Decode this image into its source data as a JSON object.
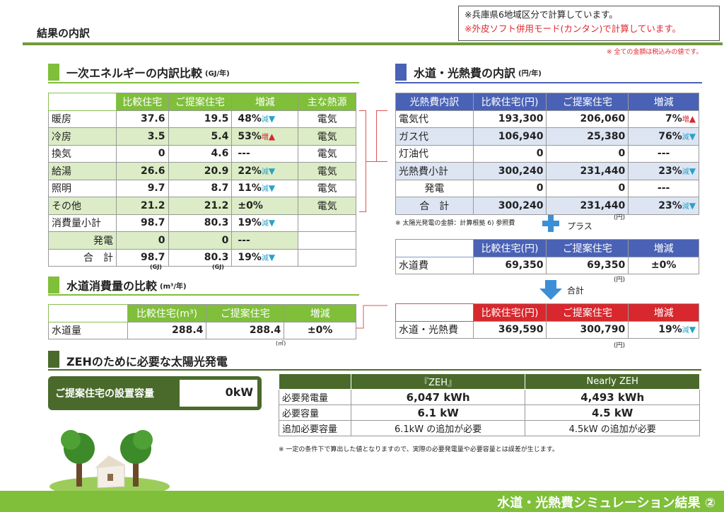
{
  "header": {
    "title": "結果の内訳",
    "note1": "※兵庫県6地域区分で計算しています。",
    "note2": "※外皮ソフト併用モード(カンタン)で計算しています。",
    "taxnote": "※ 全ての金額は税込みの値です。"
  },
  "energy": {
    "title": "一次エネルギーの内訳比較",
    "unit": "(GJ/年)",
    "headers": [
      "",
      "比較住宅",
      "ご提案住宅",
      "増減",
      "主な熱源"
    ],
    "rows": [
      {
        "label": "暖房",
        "a": "37.6",
        "b": "19.5",
        "pct": "48%",
        "dir": "減",
        "src": "電気"
      },
      {
        "label": "冷房",
        "a": "3.5",
        "b": "5.4",
        "pct": "53%",
        "dir": "増",
        "src": "電気"
      },
      {
        "label": "換気",
        "a": "0",
        "b": "4.6",
        "pct": "---",
        "dir": "",
        "src": "電気"
      },
      {
        "label": "給湯",
        "a": "26.6",
        "b": "20.9",
        "pct": "22%",
        "dir": "減",
        "src": "電気"
      },
      {
        "label": "照明",
        "a": "9.7",
        "b": "8.7",
        "pct": "11%",
        "dir": "減",
        "src": "電気"
      },
      {
        "label": "その他",
        "a": "21.2",
        "b": "21.2",
        "pct": "±0%",
        "dir": "",
        "src": "電気"
      },
      {
        "label": "消費量小計",
        "a": "98.7",
        "b": "80.3",
        "pct": "19%",
        "dir": "減",
        "src": ""
      },
      {
        "label": "発電",
        "a": "0",
        "b": "0",
        "pct": "---",
        "dir": "",
        "src": ""
      },
      {
        "label": "合　計",
        "a": "98.7",
        "b": "80.3",
        "pct": "19%",
        "dir": "減",
        "src": ""
      }
    ],
    "gj": "(GJ)"
  },
  "water": {
    "title": "水道消費量の比較",
    "unit": "(m³/年)",
    "headers": [
      "",
      "比較住宅(m³)",
      "ご提案住宅",
      "増減"
    ],
    "label": "水道量",
    "a": "288.4",
    "b": "288.4",
    "pct": "±0%",
    "m3": "(㎥)"
  },
  "cost": {
    "title": "水道・光熱費の内訳",
    "unit": "(円/年)",
    "headers": [
      "光熱費内訳",
      "比較住宅(円)",
      "ご提案住宅",
      "増減"
    ],
    "rows": [
      {
        "label": "電気代",
        "a": "193,300",
        "b": "206,060",
        "pct": "7%",
        "dir": "増"
      },
      {
        "label": "ガス代",
        "a": "106,940",
        "b": "25,380",
        "pct": "76%",
        "dir": "減"
      },
      {
        "label": "灯油代",
        "a": "0",
        "b": "0",
        "pct": "---",
        "dir": ""
      },
      {
        "label": "光熱費小計",
        "a": "300,240",
        "b": "231,440",
        "pct": "23%",
        "dir": "減"
      },
      {
        "label": "発電",
        "a": "0",
        "b": "0",
        "pct": "---",
        "dir": ""
      },
      {
        "label": "合　計",
        "a": "300,240",
        "b": "231,440",
        "pct": "23%",
        "dir": "減"
      }
    ],
    "yen": "(円)",
    "solarnote": "※ 太陽光発電の金額：計算根拠 6) 参照費",
    "plus": "プラス"
  },
  "watercost": {
    "headers": [
      "",
      "比較住宅(円)",
      "ご提案住宅",
      "増減"
    ],
    "label": "水道費",
    "a": "69,350",
    "b": "69,350",
    "pct": "±0%",
    "total": "合計"
  },
  "totalcost": {
    "headers": [
      "",
      "比較住宅(円)",
      "ご提案住宅",
      "増減"
    ],
    "label": "水道・光熱費",
    "a": "369,590",
    "b": "300,790",
    "pct": "19%",
    "dir": "減"
  },
  "zeh": {
    "title": "ZEHのために必要な太陽光発電",
    "label": "ご提案住宅の設置容量",
    "value": "0kW",
    "headers": [
      "",
      "『ZEH』",
      "Nearly ZEH"
    ],
    "rows": [
      {
        "label": "必要発電量",
        "a": "6,047 kWh",
        "b": "4,493 kWh"
      },
      {
        "label": "必要容量",
        "a": "6.1 kW",
        "b": "4.5 kW"
      },
      {
        "label": "追加必要容量",
        "a": "6.1kW の追加が必要",
        "b": "4.5kW の追加が必要"
      }
    ],
    "note": "※ 一定の条件下で算出した値となりますので、実際の必要発電量や必要容量とは誤差が生じます。"
  },
  "footer": {
    "title": "水道・光熱費シミュレーション結果 ②"
  },
  "colors": {
    "green": "#7fbf3a",
    "blue": "#4a62b5",
    "red": "#d8272d",
    "dark_green": "#4a6a2b"
  }
}
